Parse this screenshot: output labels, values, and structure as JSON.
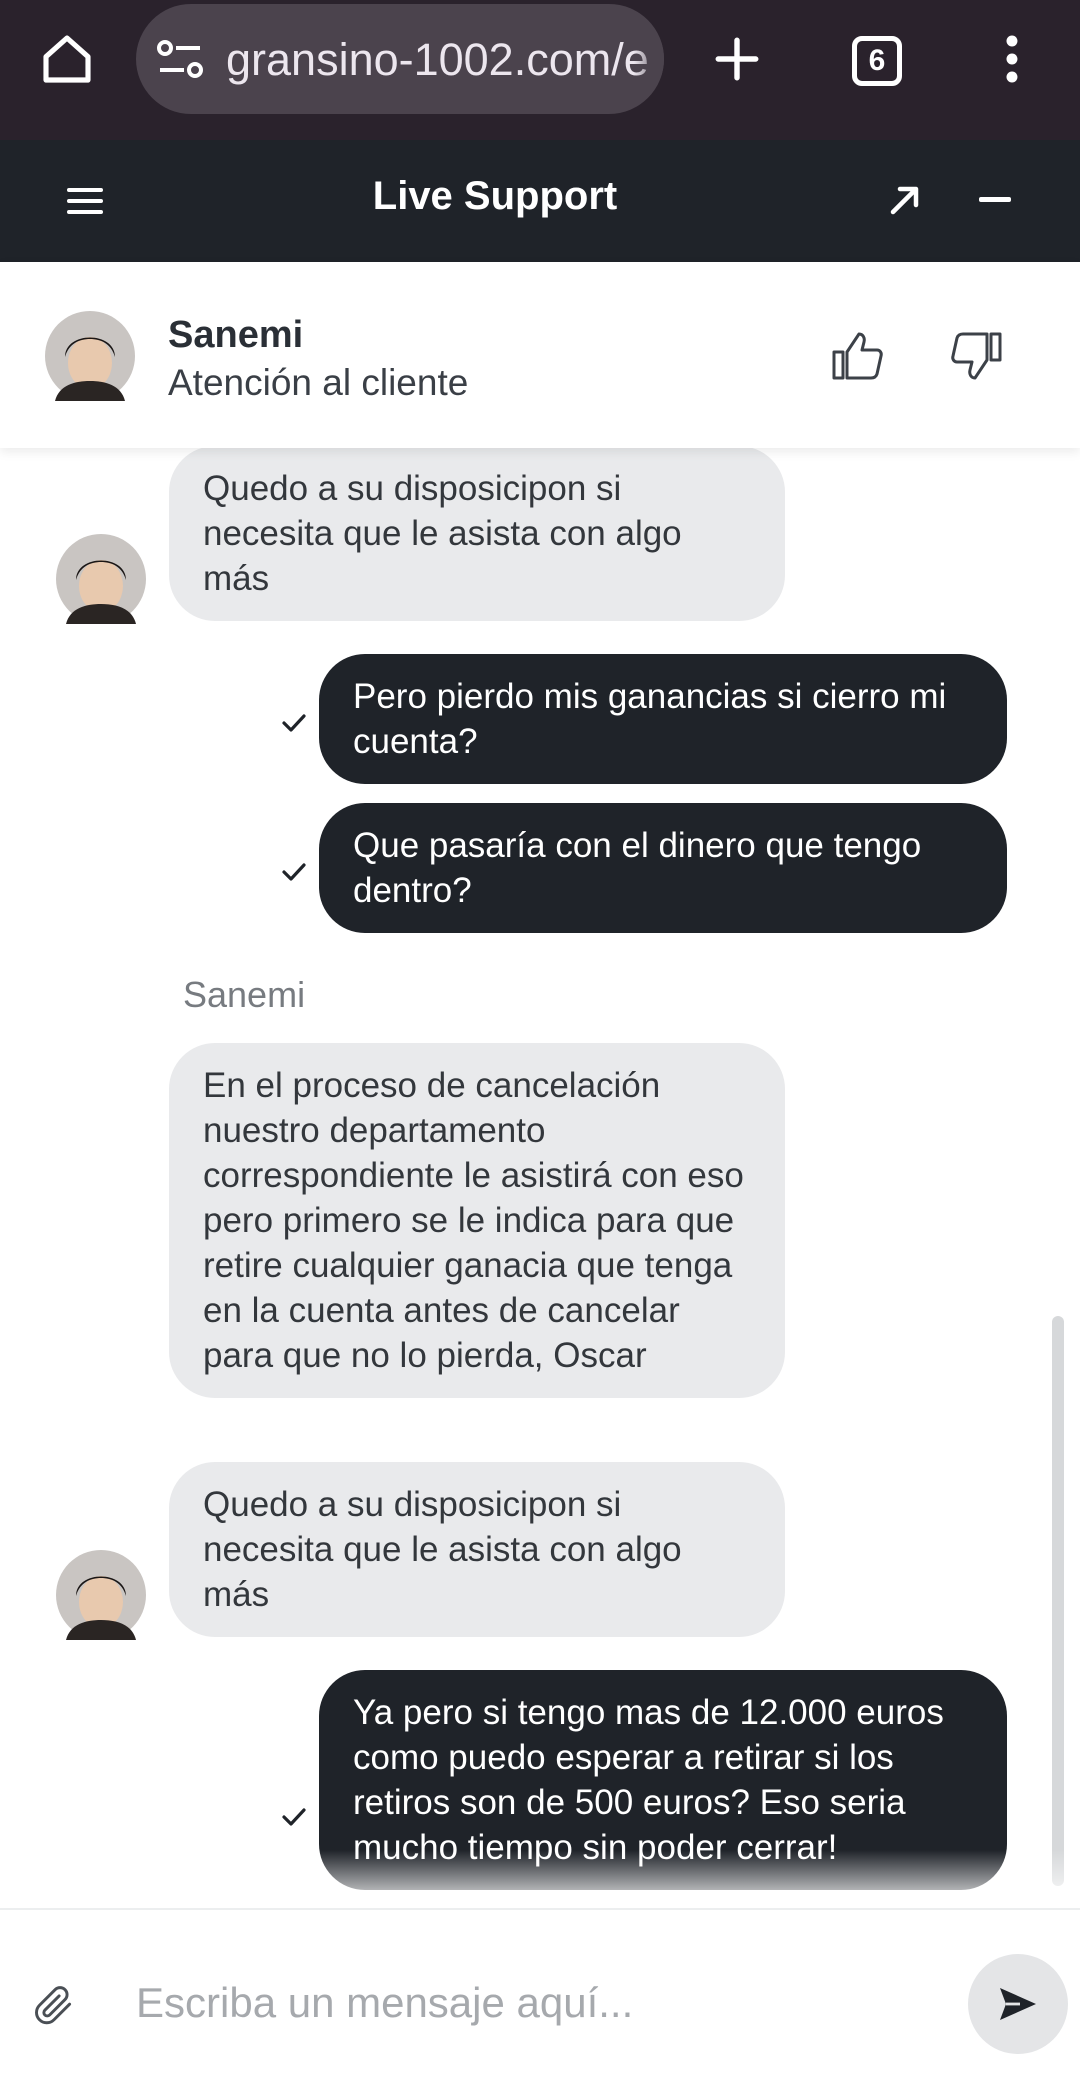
{
  "browser": {
    "url": "gransino-1002.com/e",
    "tab_count": "6",
    "icons": [
      "home-icon",
      "site-settings-icon",
      "plus-icon",
      "tabs-icon",
      "more-vert-icon"
    ],
    "bar_color": "#2a222c"
  },
  "header": {
    "title": "Live Support",
    "icons": [
      "menu-icon",
      "expand-icon",
      "minimize-icon"
    ],
    "bg_color": "#1f2329"
  },
  "agent": {
    "name": "Sanemi",
    "role": "Atención al cliente"
  },
  "messages": {
    "m1": "Quedo a su disposicipon si necesita que le asista con algo más",
    "m2": "Pero pierdo mis ganancias si cierro mi cuenta?",
    "m3": "Que pasaría con el dinero que tengo dentro?",
    "sender_label": "Sanemi",
    "m4": "En el proceso de cancelación nuestro departamento correspondiente le asistirá con eso pero primero se le indica para que retire cualquier ganacia que tenga en la cuenta antes de cancelar para que no lo pierda, Oscar",
    "m5": "Quedo a su disposicipon si necesita que le asista con algo más",
    "m6": "Ya pero si tengo mas de 12.000 euros como puedo esperar a retirar si los retiros son de 500 euros? Eso seria mucho tiempo sin poder cerrar!"
  },
  "composer": {
    "placeholder": "Escriba un mensaje aquí..."
  },
  "colors": {
    "user_bubble": "#1f2329",
    "agent_bubble": "#e9eaec"
  }
}
